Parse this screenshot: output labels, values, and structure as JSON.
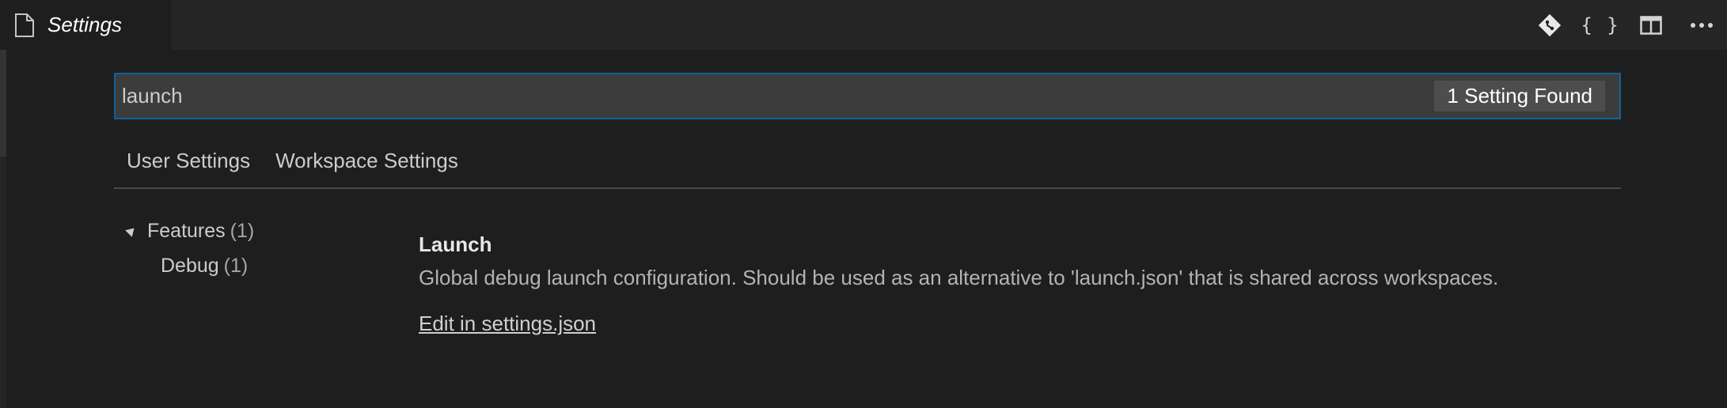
{
  "tab": {
    "label": "Settings",
    "icon": "file-icon"
  },
  "actions": [
    {
      "icon": "git-compare-icon"
    },
    {
      "icon": "braces-icon",
      "glyph": "{ }"
    },
    {
      "icon": "split-editor-icon"
    },
    {
      "icon": "more-icon"
    }
  ],
  "search": {
    "value": "launch",
    "result_count": "1 Setting Found"
  },
  "scopes": {
    "user": "User Settings",
    "workspace": "Workspace Settings"
  },
  "toc": {
    "features_label": "Features",
    "features_count": "(1)",
    "debug_label": "Debug",
    "debug_count": "(1)"
  },
  "setting": {
    "title": "Launch",
    "description": "Global debug launch configuration. Should be used as an alternative to 'launch.json' that is shared across workspaces.",
    "edit_link": "Edit in settings.json"
  },
  "colors": {
    "background": "#1e1e1e",
    "titlebar": "#252526",
    "focus_border": "#0e639c",
    "input_background": "#3c3c3c"
  }
}
